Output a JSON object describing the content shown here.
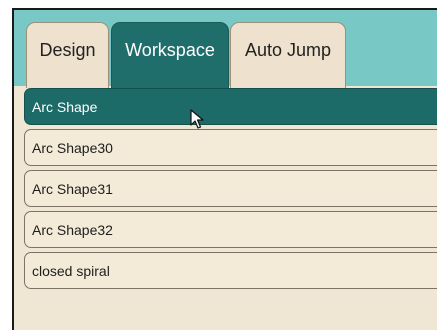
{
  "tabs": [
    {
      "label": "Design",
      "active": false
    },
    {
      "label": "Workspace",
      "active": true
    },
    {
      "label": "Auto Jump",
      "active": false
    }
  ],
  "shapes": [
    {
      "label": "Arc Shape",
      "selected": true
    },
    {
      "label": "Arc Shape30",
      "selected": false
    },
    {
      "label": "Arc Shape31",
      "selected": false
    },
    {
      "label": "Arc Shape32",
      "selected": false
    },
    {
      "label": "closed spiral",
      "selected": false
    }
  ],
  "colors": {
    "accent": "#1f6e6b",
    "tab_strip": "#78c9c6",
    "panel_bg": "#efe6d4",
    "item_bg": "#f3ead8"
  },
  "icons": {
    "cursor": "mouse-pointer-icon"
  }
}
